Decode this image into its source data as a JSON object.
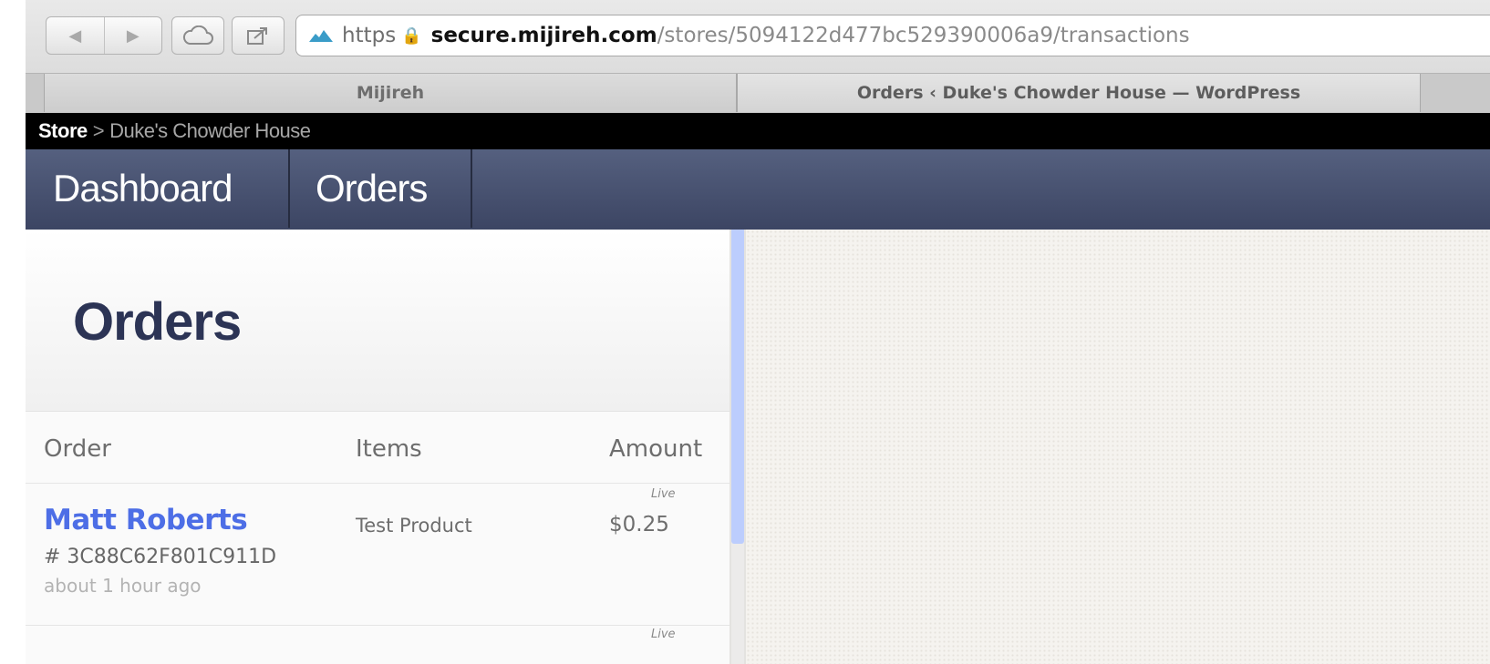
{
  "browser": {
    "url": {
      "scheme": "https",
      "host": "secure.mijireh.com",
      "path": "/stores/5094122d477bc529390006a9/transactions"
    },
    "tabs": [
      {
        "title": "Mijireh",
        "active": false
      },
      {
        "title": "Orders ‹ Duke's Chowder House — WordPress",
        "active": true
      }
    ],
    "icons": {
      "back": "back-arrow-icon",
      "forward": "forward-arrow-icon",
      "icloud": "cloud-icon",
      "share": "share-icon",
      "lock": "lock-icon"
    }
  },
  "breadcrumb": {
    "root": "Store",
    "separator": ">",
    "current": "Duke's Chowder House"
  },
  "nav": {
    "items": [
      {
        "label": "Dashboard"
      },
      {
        "label": "Orders"
      }
    ]
  },
  "page": {
    "title": "Orders",
    "table": {
      "columns": [
        "Order",
        "Items",
        "Amount"
      ],
      "rows": [
        {
          "customer": "Matt Roberts",
          "order_id": "# 3C88C62F801C911D",
          "time": "about 1 hour ago",
          "item": "Test Product",
          "mode": "Live",
          "amount": "$0.25"
        },
        {
          "mode": "Live"
        }
      ]
    }
  },
  "colors": {
    "nav_bg": "#46506f",
    "title": "#2c3455",
    "link": "#4d6ee6",
    "scroll_thumb": "#bccdfd"
  }
}
